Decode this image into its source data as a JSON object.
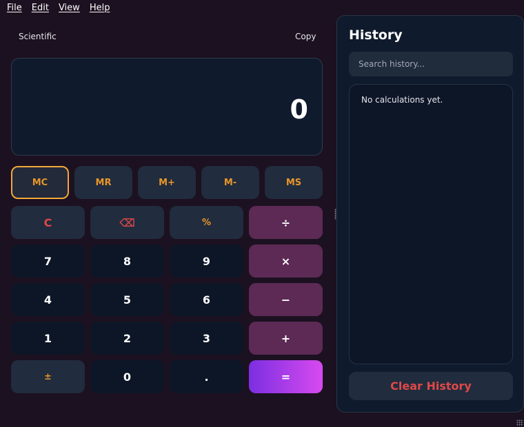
{
  "menu": {
    "items": [
      "File",
      "Edit",
      "View",
      "Help"
    ]
  },
  "toolbar": {
    "mode": "Scientific",
    "copy": "Copy"
  },
  "display": {
    "value": "0"
  },
  "memory": {
    "buttons": [
      "MC",
      "MR",
      "M+",
      "M-",
      "MS"
    ],
    "active": "MC"
  },
  "keypad": {
    "clear": "C",
    "backspace": "⌫",
    "percent": "%",
    "divide": "÷",
    "seven": "7",
    "eight": "8",
    "nine": "9",
    "multiply": "×",
    "four": "4",
    "five": "5",
    "six": "6",
    "subtract": "−",
    "one": "1",
    "two": "2",
    "three": "3",
    "add": "+",
    "negate": "±",
    "zero": "0",
    "decimal": ".",
    "equals": "="
  },
  "history": {
    "title": "History",
    "search_placeholder": "Search history...",
    "empty_message": "No calculations yet.",
    "clear_label": "Clear History"
  },
  "colors": {
    "background": "#1c1120",
    "panel": "#0f1a2c",
    "accent_orange": "#e8962a",
    "accent_red": "#e04848",
    "operator": "#5c2a55",
    "equals_gradient_start": "#7b2fe0",
    "equals_gradient_end": "#d84af0"
  }
}
